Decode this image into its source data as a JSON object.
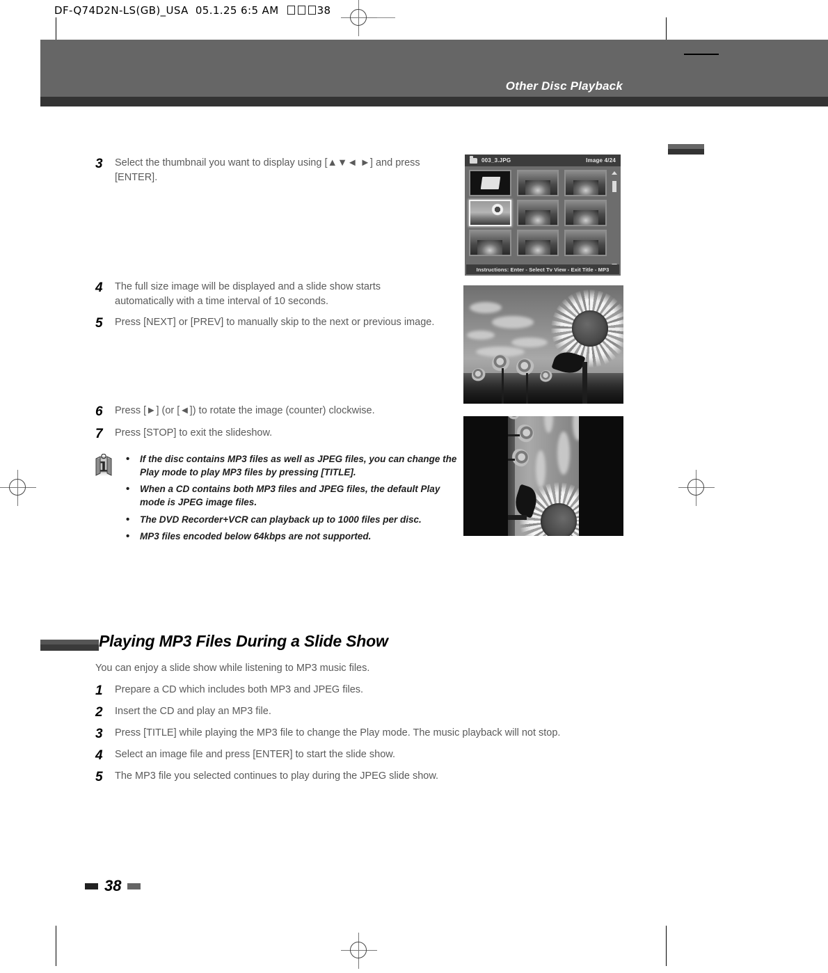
{
  "scan_slug": {
    "filename": "DF-Q74D2N-LS(GB)_USA",
    "date": "05.1.25",
    "time": "6:5 AM",
    "page_marker": "38"
  },
  "header": {
    "title": "Other Disc Playback"
  },
  "steps_top": [
    {
      "num": "3",
      "text": "Select the thumbnail you want to display using [▲▼◄ ►] and press [ENTER]."
    },
    {
      "num": "4",
      "text": "The full size image will be displayed and a slide show starts automatically with a time interval of 10 seconds."
    },
    {
      "num": "5",
      "text": "Press [NEXT] or [PREV] to manually skip to the next or previous image."
    },
    {
      "num": "6",
      "text": "Press [►] (or [◄]) to rotate the image (counter) clockwise."
    },
    {
      "num": "7",
      "text": "Press [STOP] to exit the slideshow."
    }
  ],
  "note": {
    "icon": "info-icon",
    "bullets": [
      "If the disc contains MP3 files as well as JPEG files, you can change the Play mode to play MP3 files by pressing [TITLE].",
      "When a CD contains both MP3 files and JPEG files, the default Play mode is JPEG image files.",
      "The DVD Recorder+VCR can playback up to 1000 files per disc.",
      "MP3 files encoded below 64kbps are not supported."
    ]
  },
  "section": {
    "title": "Playing MP3 Files During a Slide Show",
    "intro": "You can enjoy a slide show while listening to MP3 music files.",
    "steps": [
      {
        "num": "1",
        "text": "Prepare a CD which includes both MP3 and JPEG files."
      },
      {
        "num": "2",
        "text": "Insert the CD and play an MP3 file."
      },
      {
        "num": "3",
        "text": "Press [TITLE] while playing the MP3 file to change the Play mode. The music playback will not stop."
      },
      {
        "num": "4",
        "text": "Select an image file and press [ENTER] to start the slide show."
      },
      {
        "num": "5",
        "text": "The MP3 file you selected continues to play during the JPEG slide show."
      }
    ]
  },
  "osd": {
    "filename": "003_3.JPG",
    "image_count": "Image 4/24",
    "instructions": "Instructions: Enter - Select  Tv View - Exit  Title - MP3",
    "thumbnails": [
      {
        "kind": "folder",
        "selected": false
      },
      {
        "kind": "people",
        "selected": false
      },
      {
        "kind": "people",
        "selected": false
      },
      {
        "kind": "sunflower",
        "selected": true
      },
      {
        "kind": "people",
        "selected": false
      },
      {
        "kind": "people",
        "selected": false
      },
      {
        "kind": "people",
        "selected": false
      },
      {
        "kind": "people",
        "selected": false
      },
      {
        "kind": "people",
        "selected": false
      }
    ]
  },
  "photos": [
    {
      "name": "full-size-sunflower",
      "caption": ""
    },
    {
      "name": "rotated-sunflower",
      "caption": ""
    }
  ],
  "footer": {
    "page_number": "38"
  },
  "colors": {
    "header_band": "#666666",
    "header_underbar": "#333333",
    "body_text": "#5a5a5a",
    "osd_bg": "#6d6d6d",
    "osd_bar": "#3c3c3c"
  }
}
